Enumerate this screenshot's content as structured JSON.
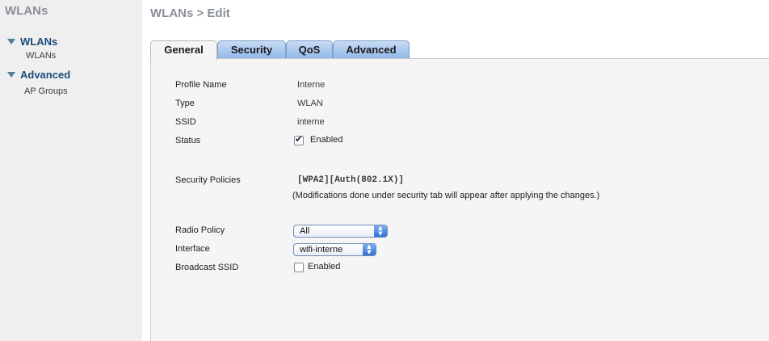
{
  "sidebar": {
    "title": "WLANs",
    "groups": [
      {
        "label": "WLANs",
        "items": [
          {
            "label": "WLANs"
          }
        ]
      },
      {
        "label": "Advanced",
        "items": [
          {
            "label": "AP Groups"
          }
        ]
      }
    ]
  },
  "header": {
    "title": "WLANs > Edit"
  },
  "tabs": [
    {
      "label": "General",
      "active": true
    },
    {
      "label": "Security",
      "active": false
    },
    {
      "label": "QoS",
      "active": false
    },
    {
      "label": "Advanced",
      "active": false
    }
  ],
  "form": {
    "profile_name": {
      "label": "Profile Name",
      "value": "Interne"
    },
    "type": {
      "label": "Type",
      "value": "WLAN"
    },
    "ssid": {
      "label": "SSID",
      "value": "interne"
    },
    "status": {
      "label": "Status",
      "checkbox_label": "Enabled",
      "checked": true
    },
    "security_policies": {
      "label": "Security Policies",
      "value": "[WPA2][Auth(802.1X)]",
      "note": "(Modifications done under security tab will appear after applying the changes.)"
    },
    "radio_policy": {
      "label": "Radio Policy",
      "selected": "All"
    },
    "interface": {
      "label": "Interface",
      "selected": "wifi-interne"
    },
    "broadcast_ssid": {
      "label": "Broadcast SSID",
      "checkbox_label": "Enabled",
      "checked": false
    }
  },
  "icons": {
    "group_toggle": "triangle-down-icon",
    "checkbox_checked": "checkmark-icon",
    "select_arrows": "up-down-arrows-icon"
  },
  "colors": {
    "sidebar_bg": "#efefef",
    "tab_blue": "#93b9ec",
    "link_blue": "#1b4c7a",
    "panel_bg": "#f5f5f5"
  }
}
